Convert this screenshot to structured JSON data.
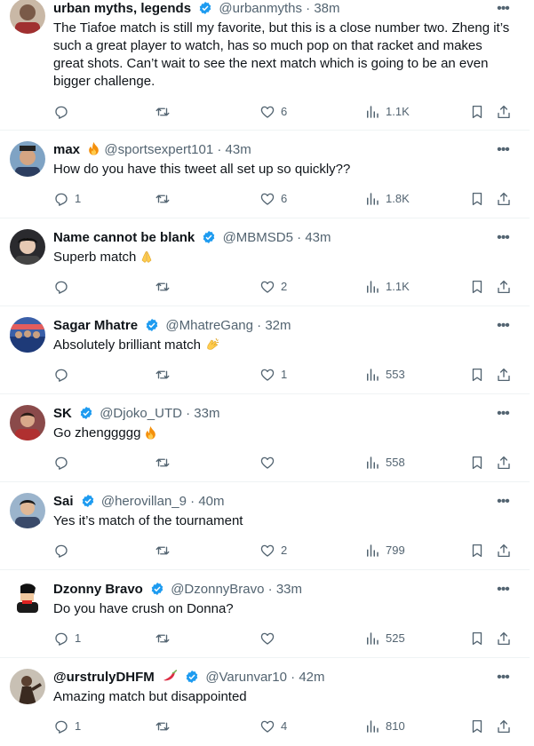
{
  "replies": [
    {
      "name": "urban myths, legends",
      "handle": "@urbanmyths",
      "time": "38m",
      "text": "The Tiafoe match is still my favorite, but this is a close number two. Zheng it’s such a great player to watch, has so much pop on that racket and makes great shots. Can’t wait to see the next match which is going to be an even bigger challenge.",
      "replies": "",
      "retweets": "",
      "likes": "6",
      "views": "1.1K"
    },
    {
      "name": "max",
      "handle": "@sportsexpert101",
      "time": "43m",
      "text": "How do you have this tweet all set up so quickly??",
      "replies": "1",
      "retweets": "",
      "likes": "6",
      "views": "1.8K"
    },
    {
      "name": "Name cannot be blank",
      "handle": "@MBMSD5",
      "time": "43m",
      "text": "Superb match",
      "replies": "",
      "retweets": "",
      "likes": "2",
      "views": "1.1K"
    },
    {
      "name": "Sagar Mhatre",
      "handle": "@MhatreGang",
      "time": "32m",
      "text": "Absolutely brilliant match",
      "replies": "",
      "retweets": "",
      "likes": "1",
      "views": "553"
    },
    {
      "name": "SK",
      "handle": "@Djoko_UTD",
      "time": "33m",
      "text": "Go zhenggggg",
      "replies": "",
      "retweets": "",
      "likes": "",
      "views": "558"
    },
    {
      "name": "Sai",
      "handle": "@herovillan_9",
      "time": "40m",
      "text": "Yes it’s match of the tournament",
      "replies": "",
      "retweets": "",
      "likes": "2",
      "views": "799"
    },
    {
      "name": "Dzonny Bravo",
      "handle": "@DzonnyBravo",
      "time": "33m",
      "text": "Do you have crush on Donna?",
      "replies": "1",
      "retweets": "",
      "likes": "",
      "views": "525"
    },
    {
      "name": "@urstrulyDHFM",
      "handle": "@Varunvar10",
      "time": "42m",
      "text": "Amazing match but disappointed",
      "replies": "1",
      "retweets": "",
      "likes": "4",
      "views": "810"
    }
  ],
  "separator": "·",
  "icons": {
    "reply": "reply-icon",
    "retweet": "retweet-icon",
    "like": "heart-icon",
    "views": "views-icon",
    "bookmark": "bookmark-icon",
    "share": "share-icon",
    "more": "more-icon",
    "verified": "verified-badge-icon"
  },
  "colors": {
    "text": "#0f1419",
    "secondary": "#536471",
    "verified": "#1d9bf0",
    "divider": "#eff3f4"
  }
}
